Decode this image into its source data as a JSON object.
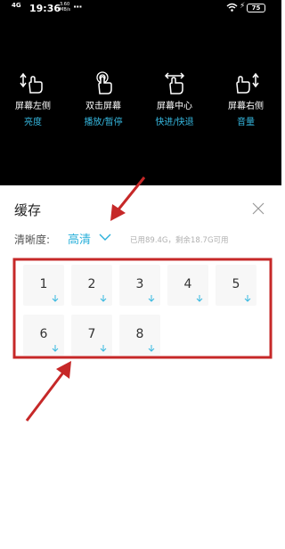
{
  "status_bar": {
    "signal": "4G",
    "time": "19:36",
    "net_speed_value": "3.60",
    "net_speed_unit": "MB/s",
    "more": "···",
    "battery": "75"
  },
  "gestures": [
    {
      "title": "屏幕左侧",
      "subtitle": "亮度",
      "icon": "swipe-vertical-left-hand-icon"
    },
    {
      "title": "双击屏幕",
      "subtitle": "播放/暂停",
      "icon": "double-tap-hand-icon"
    },
    {
      "title": "屏幕中心",
      "subtitle": "快进/快退",
      "icon": "swipe-horizontal-hand-icon"
    },
    {
      "title": "屏幕右侧",
      "subtitle": "音量",
      "icon": "swipe-vertical-right-hand-icon"
    }
  ],
  "panel": {
    "title": "缓存",
    "definition_label": "清晰度:",
    "definition_value": "高清",
    "storage_info": "已用89.4G，剩余18.7G可用"
  },
  "episodes": [
    "1",
    "2",
    "3",
    "4",
    "5",
    "6",
    "7",
    "8"
  ],
  "colors": {
    "accent": "#2ab0da",
    "annotation": "#c62828",
    "background_dark": "#000000"
  }
}
